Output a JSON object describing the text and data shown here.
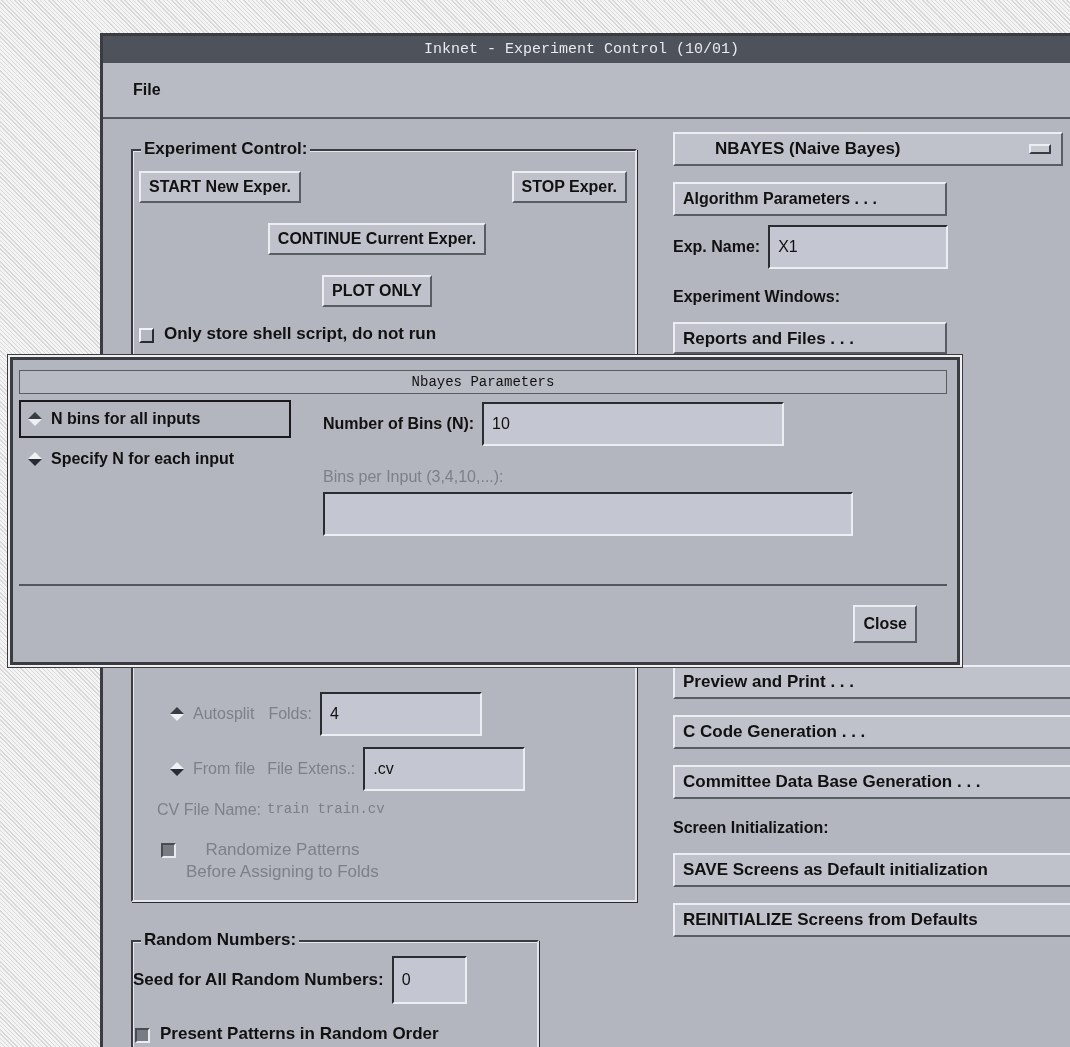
{
  "window": {
    "title": "Inknet - Experiment Control (10/01)",
    "menu": [
      "File"
    ]
  },
  "experiment_control": {
    "title": "Experiment Control:",
    "buttons": [
      "START New Exper.",
      "STOP Exper.",
      "CONTINUE Current Exper.",
      "PLOT ONLY"
    ],
    "script_option": {
      "label": "Only store shell script, do not run",
      "checked": false
    },
    "cv": {
      "disabled": true,
      "options": [
        {
          "label": "Autosplit",
          "selected": true,
          "field_label": "Folds:",
          "value": "4"
        },
        {
          "label": "From file",
          "selected": false,
          "field_label": "File Extens.:",
          "value": ".cv"
        }
      ],
      "file_name_label": "CV File Name:",
      "file_name": "train train.cv",
      "randomize": {
        "label": "Randomize Patterns\nBefore Assigning to Folds",
        "checked": true
      }
    }
  },
  "random_numbers": {
    "title": "Random Numbers:",
    "seed_label": "Seed for All Random Numbers:",
    "seed": "0",
    "order_option": {
      "label": "Present Patterns in Random Order",
      "checked": true
    }
  },
  "algorithm": {
    "menu": "NBAYES (Naive Bayes)",
    "params_button": "Algorithm Parameters . . .",
    "exp_name_label": "Exp. Name:",
    "exp_name": "X1",
    "windows_label": "Experiment Windows:",
    "window_buttons": [
      "Reports and Files . . .",
      "Preview and Print . . .",
      "C Code Generation . . .",
      "Committee Data Base Generation . . ."
    ],
    "init_label": "Screen Initialization:",
    "init_buttons": [
      "SAVE Screens as Default initialization",
      "REINITIALIZE Screens from Defaults"
    ]
  },
  "dialog": {
    "title": "Nbayes Parameters",
    "options": [
      {
        "label": "N bins for all inputs",
        "selected": true
      },
      {
        "label": "Specify N for each input",
        "selected": false
      }
    ],
    "bins_label": "Number of Bins (N):",
    "bins_value": "10",
    "per_input_label": "Bins per Input (3,4,10,...):",
    "per_input_disabled": true,
    "close": "Close"
  }
}
